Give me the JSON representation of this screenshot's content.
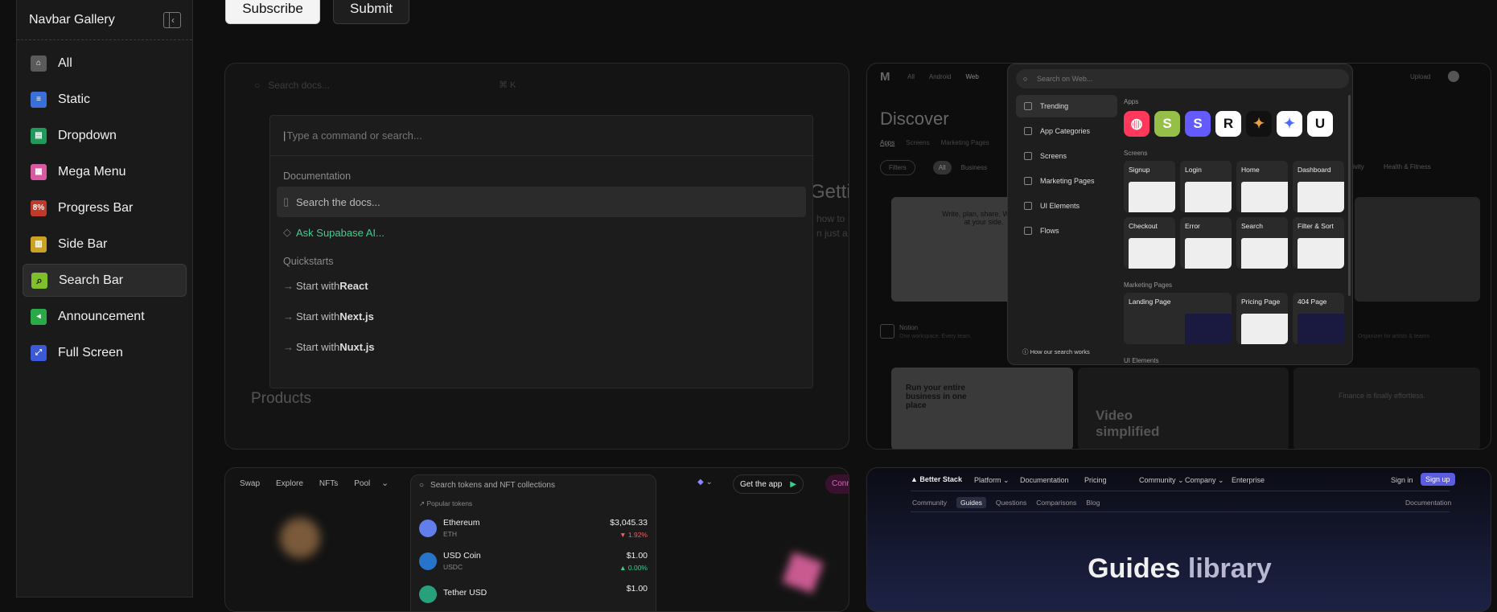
{
  "sidebar": {
    "title": "Navbar Gallery",
    "items": [
      {
        "label": "All",
        "icon": "house-icon",
        "color": "#5a5a5a"
      },
      {
        "label": "Static",
        "icon": "static-icon",
        "color": "#3a6fd8"
      },
      {
        "label": "Dropdown",
        "icon": "dropdown-icon",
        "color": "#1f9a5b"
      },
      {
        "label": "Mega Menu",
        "icon": "mega-menu-icon",
        "color": "#d85aa0"
      },
      {
        "label": "Progress Bar",
        "icon": "progress-icon",
        "color": "#c0392b",
        "badge": "8%"
      },
      {
        "label": "Side Bar",
        "icon": "sidebar-icon",
        "color": "#c9a227"
      },
      {
        "label": "Search Bar",
        "icon": "search-icon",
        "color": "#7fbf2a"
      },
      {
        "label": "Announcement",
        "icon": "announcement-icon",
        "color": "#2aa84a"
      },
      {
        "label": "Full Screen",
        "icon": "fullscreen-icon",
        "color": "#3c5ad8"
      }
    ],
    "active_index": 6
  },
  "buttons": {
    "subscribe": "Subscribe",
    "submit": "Submit"
  },
  "card1": {
    "bg_search": "Search docs...",
    "bg_kbd": "⌘ K",
    "bg_heading": "Getti",
    "bg_sub1": "how to",
    "bg_sub2": "n just a",
    "bg_products": "Products",
    "palette": {
      "placeholder": "Type a command or search...",
      "section1": "Documentation",
      "search_docs": "Search the docs...",
      "ask_ai": "Ask Supabase AI...",
      "section2": "Quickstarts",
      "quick": [
        {
          "prefix": "Start with ",
          "name": "React"
        },
        {
          "prefix": "Start with ",
          "name": "Next.js"
        },
        {
          "prefix": "Start with ",
          "name": "Nuxt.js"
        }
      ]
    }
  },
  "card2": {
    "nav": [
      "All",
      "Android",
      "Web"
    ],
    "upload": "Upload",
    "discover": "Discover",
    "tabs": [
      "Apps",
      "Screens",
      "Marketing Pages"
    ],
    "filters": "Filters",
    "chip_all": "All",
    "chip_business": "Business",
    "chip_activity": "ivity",
    "chip_health": "Health & Fitness",
    "notion_title": "Notion",
    "notion_desc": "One workspace. Every team.",
    "tile1_text": "Write, plan, share. With AI at your side.",
    "tile2_text": "Run your entire business in one place",
    "tile3_text": "Video simplified",
    "tile4_text": "Finance is finally effortless.",
    "side_note": "Organizer for artists & teams",
    "modal": {
      "search": "Search on Web...",
      "menu": [
        "Trending",
        "App Categories",
        "Screens",
        "Marketing Pages",
        "UI Elements",
        "Flows"
      ],
      "footer": "How our search works",
      "apps_label": "Apps",
      "screens_label": "Screens",
      "screens": [
        "Signup",
        "Login",
        "Home",
        "Dashboard",
        "Checkout",
        "Error",
        "Search",
        "Filter & Sort"
      ],
      "marketing_label": "Marketing Pages",
      "marketing": [
        "Landing Page",
        "Pricing Page",
        "404 Page"
      ],
      "ui_label": "UI Elements"
    }
  },
  "card3": {
    "nav": [
      "Swap",
      "Explore",
      "NFTs",
      "Pool"
    ],
    "get_app": "Get the app",
    "connect": "Conn",
    "search": "Search tokens and NFT collections",
    "popular": "Popular tokens",
    "tokens": [
      {
        "name": "Ethereum",
        "symbol": "ETH",
        "price": "$3,045.33",
        "change": "▼ 1.92%",
        "change_color": "#ff5a5a",
        "color": "#627eea"
      },
      {
        "name": "USD Coin",
        "symbol": "USDC",
        "price": "$1.00",
        "change": "▲ 0.00%",
        "change_color": "#3ecf8e",
        "color": "#2775ca"
      },
      {
        "name": "Tether USD",
        "symbol": "",
        "price": "$1.00",
        "change": "",
        "change_color": "#3ecf8e",
        "color": "#26a17b"
      }
    ]
  },
  "card4": {
    "logo": "Better Stack",
    "nav": [
      "Platform ⌄",
      "Documentation",
      "Pricing",
      "Community ⌄",
      "Company ⌄",
      "Enterprise"
    ],
    "sign_in": "Sign in",
    "sign_up": "Sign up",
    "subnav": [
      "Community",
      "Guides",
      "Questions",
      "Comparisons",
      "Blog"
    ],
    "subnav_right": "Documentation",
    "headline_a": "Guides",
    "headline_b": " library"
  }
}
